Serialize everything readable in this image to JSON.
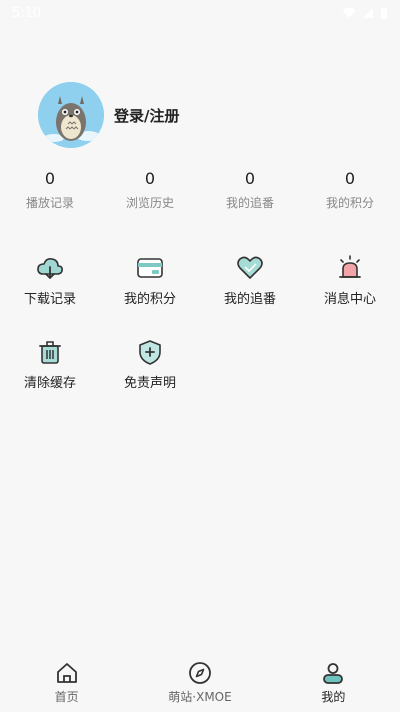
{
  "status_bar": {
    "time": "5:10"
  },
  "profile": {
    "login_label": "登录/注册"
  },
  "stats": [
    {
      "value": "0",
      "label": "播放记录"
    },
    {
      "value": "0",
      "label": "浏览历史"
    },
    {
      "value": "0",
      "label": "我的追番"
    },
    {
      "value": "0",
      "label": "我的积分"
    }
  ],
  "menu": [
    {
      "label": "下载记录",
      "icon": "cloud-download-icon"
    },
    {
      "label": "我的积分",
      "icon": "card-icon"
    },
    {
      "label": "我的追番",
      "icon": "heart-icon"
    },
    {
      "label": "消息中心",
      "icon": "alarm-icon"
    },
    {
      "label": "清除缓存",
      "icon": "trash-icon"
    },
    {
      "label": "免责声明",
      "icon": "shield-icon"
    }
  ],
  "tabs": [
    {
      "label": "首页",
      "icon": "home-icon"
    },
    {
      "label": "萌站·XMOE",
      "icon": "compass-icon"
    },
    {
      "label": "我的",
      "icon": "profile-icon"
    }
  ],
  "colors": {
    "background": "#f7f7f8",
    "accent_teal": "#5bb8b4",
    "avatar_bg": "#8fd0ef"
  }
}
